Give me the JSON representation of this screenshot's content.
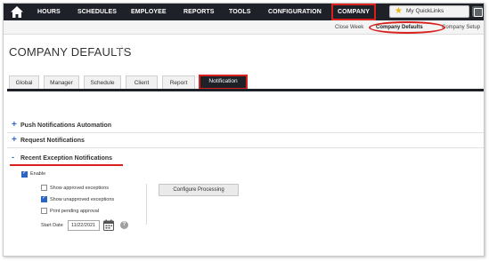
{
  "topnav": {
    "items": [
      "HOURS",
      "SCHEDULES",
      "EMPLOYEE",
      "REPORTS",
      "TOOLS",
      "CONFIGURATION",
      "COMPANY"
    ],
    "active": "COMPANY",
    "quicklinks_label": "My QuickLinks",
    "background_color": "#1e2127",
    "highlight_color": "#d8201d"
  },
  "subnav": {
    "items": [
      "Close Week",
      "Company Defaults",
      "Company Setup"
    ],
    "active": "Company Defaults"
  },
  "page": {
    "title": "COMPANY DEFAULTS"
  },
  "tabs": {
    "items": [
      "Global",
      "Manager",
      "Schedule",
      "Client",
      "Report",
      "Notification"
    ],
    "active": "Notification"
  },
  "sections": {
    "push": "Push Notifications Automation",
    "request": "Request Notifications",
    "recent": "Recent Exception Notifications"
  },
  "recent_exceptions": {
    "enable_label": "Enable",
    "enable_checked": true,
    "show_approved_label": "Show approved exceptions",
    "show_approved_checked": false,
    "show_unapproved_label": "Show unapproved exceptions",
    "show_unapproved_checked": true,
    "print_pending_label": "Print pending approval",
    "print_pending_checked": false,
    "start_date_label": "Start Date",
    "start_date_value": "11/22/2021",
    "configure_button": "Configure Processing",
    "help_glyph": "?"
  },
  "icons": {
    "home": "home-icon",
    "star": "star-icon",
    "calendar": "calendar-icon",
    "help": "help-icon",
    "qr": "qr-code-icon"
  }
}
